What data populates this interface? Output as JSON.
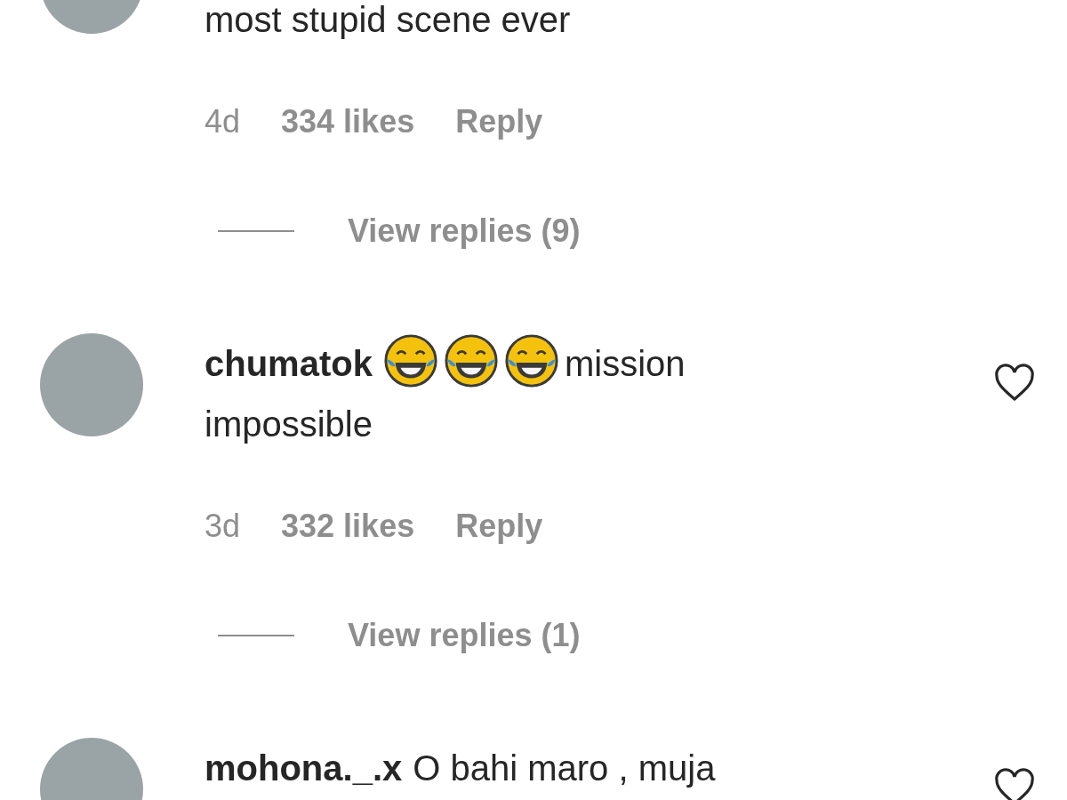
{
  "comments": [
    {
      "parts": [
        {
          "kind": "text",
          "text": "most stupid scene ever"
        }
      ],
      "meta": {
        "time": "4d",
        "likes": "334 likes",
        "reply": "Reply"
      },
      "view_replies": "View replies (9)"
    },
    {
      "username": "chumatok",
      "liked": false,
      "parts": [
        {
          "kind": "emoji"
        },
        {
          "kind": "emoji"
        },
        {
          "kind": "emoji"
        },
        {
          "kind": "text",
          "text": "mission"
        },
        {
          "kind": "text",
          "text": "impossible"
        }
      ],
      "meta": {
        "time": "3d",
        "likes": "332 likes",
        "reply": "Reply"
      },
      "view_replies": "View replies (1)"
    },
    {
      "username": "mohona._.x",
      "liked": false,
      "parts": [
        {
          "kind": "text",
          "text": "O bahi maro , muja"
        }
      ]
    }
  ]
}
